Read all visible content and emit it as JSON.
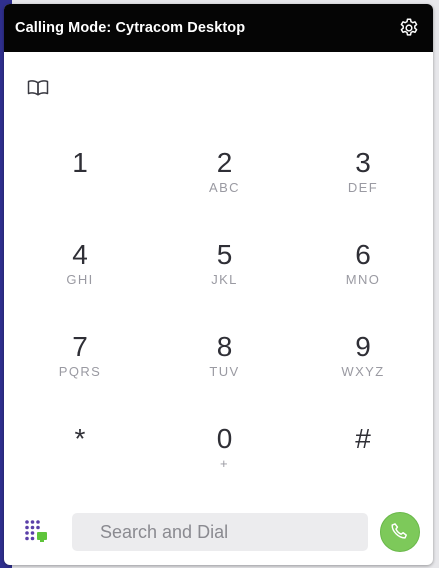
{
  "header": {
    "title": "Calling Mode: Cytracom Desktop",
    "settings_icon": "gear-icon"
  },
  "toolbar": {
    "contacts_icon": "book-icon"
  },
  "keypad": [
    {
      "digit": "1",
      "letters": ""
    },
    {
      "digit": "2",
      "letters": "ABC"
    },
    {
      "digit": "3",
      "letters": "DEF"
    },
    {
      "digit": "4",
      "letters": "GHI"
    },
    {
      "digit": "5",
      "letters": "JKL"
    },
    {
      "digit": "6",
      "letters": "MNO"
    },
    {
      "digit": "7",
      "letters": "PQRS"
    },
    {
      "digit": "8",
      "letters": "TUV"
    },
    {
      "digit": "9",
      "letters": "WXYZ"
    },
    {
      "digit": "*",
      "letters": ""
    },
    {
      "digit": "0",
      "letters": "+"
    },
    {
      "digit": "#",
      "letters": ""
    }
  ],
  "footer": {
    "search_placeholder": "Search and Dial",
    "search_value": "",
    "dialpad_icon": "dialpad-icon",
    "call_icon": "phone-icon"
  },
  "colors": {
    "header_bg": "#050505",
    "accent_purple": "#5a3fa8",
    "call_green": "#7dc95a",
    "status_green": "#5ec43a",
    "left_strip": "#2f2f8e"
  }
}
